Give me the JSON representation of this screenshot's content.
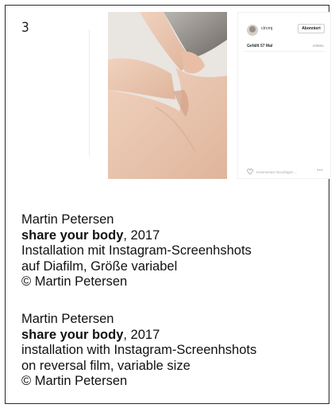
{
  "slide": {
    "number": "3"
  },
  "instagram": {
    "username": "clrcmj",
    "follow_label": "Abonniert",
    "likes": "Gefällt 57 Mal",
    "time": "108Wo.",
    "comment_placeholder": "Kommentar hinzufügen ...",
    "more": "•••"
  },
  "captions": [
    {
      "artist": "Martin Petersen",
      "title": "share your body",
      "year": ", 2017",
      "medium_line1": "Installation mit Instagram-Screenhshots",
      "medium_line2": "auf Diafilm, Größe variabel",
      "credit": "© Martin Petersen"
    },
    {
      "artist": "Martin Petersen",
      "title": "share your body",
      "year": ", 2017",
      "medium_line1": "installation with Instagram-Screenhshots",
      "medium_line2": "on reversal film, variable size",
      "credit": "© Martin Petersen"
    }
  ],
  "colors": {
    "border": "#2a2a2a",
    "skin": "#e9c4ad",
    "hair": "#8e8a86",
    "wall": "#e8e3df"
  }
}
